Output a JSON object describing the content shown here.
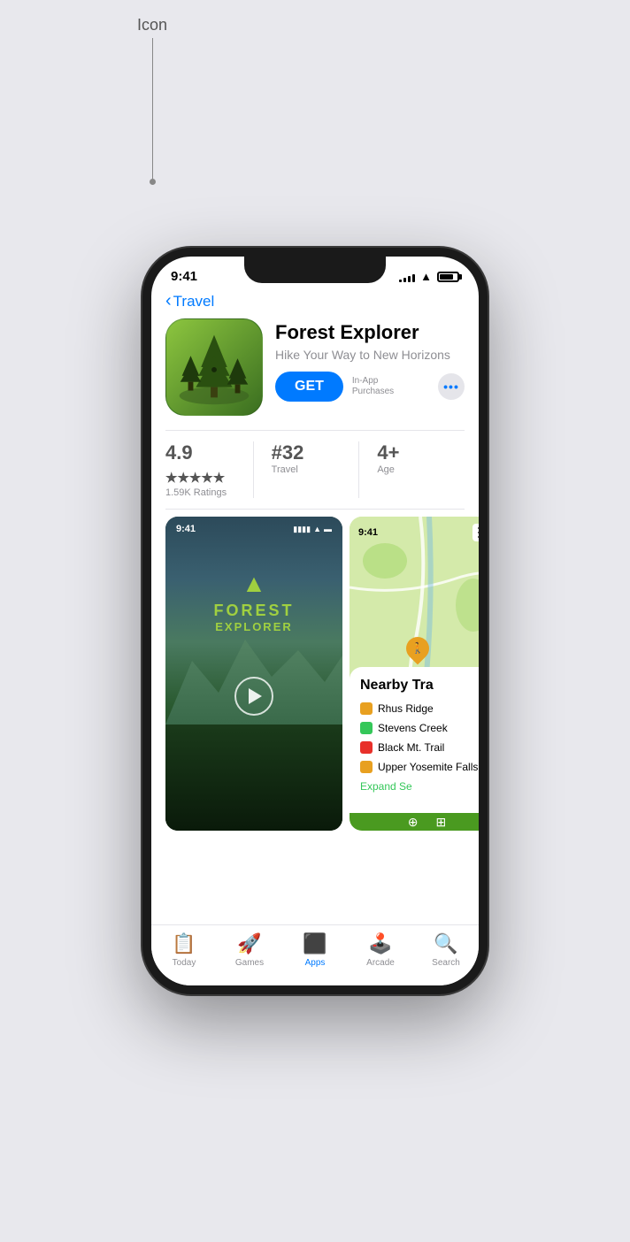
{
  "annotation": {
    "label": "Icon",
    "line_height": 160
  },
  "phone": {
    "status_bar": {
      "time": "9:41",
      "signal_bars": [
        3,
        5,
        7,
        9,
        11
      ],
      "wifi": "wifi",
      "battery_pct": 80
    },
    "back_nav": {
      "chevron": "‹",
      "label": "Travel"
    },
    "app": {
      "name": "Forest Explorer",
      "subtitle": "Hike Your Way to New Horizons",
      "get_button": "GET",
      "in_app_text": "In-App\nPurchases",
      "more_button": "•••"
    },
    "ratings": {
      "score": "4.9",
      "stars": "★★★★★",
      "ratings_count": "1.59K Ratings",
      "rank": "#32",
      "category": "Travel",
      "age": "4+",
      "age_label": "Age"
    },
    "screenshots": [
      {
        "type": "video",
        "time": "9:41",
        "title": "FOREST",
        "subtitle": "EXPLORER"
      },
      {
        "type": "map",
        "time": "9:41",
        "nearby_title": "Nearby Tra",
        "trails": [
          {
            "name": "Rhus Ridge",
            "color": "#e8a020"
          },
          {
            "name": "Stevens Creek",
            "color": "#34c759"
          },
          {
            "name": "Black Mt. Trail",
            "color": "#e8302a"
          },
          {
            "name": "Upper Yosemite Falls",
            "color": "#e8a020"
          }
        ],
        "expand": "Expand Se"
      }
    ],
    "tab_bar": {
      "items": [
        {
          "label": "Today",
          "icon": "📋",
          "active": false
        },
        {
          "label": "Games",
          "icon": "🚀",
          "active": false
        },
        {
          "label": "Apps",
          "icon": "📚",
          "active": true
        },
        {
          "label": "Arcade",
          "icon": "🕹️",
          "active": false
        },
        {
          "label": "Search",
          "icon": "🔍",
          "active": false
        }
      ]
    }
  }
}
